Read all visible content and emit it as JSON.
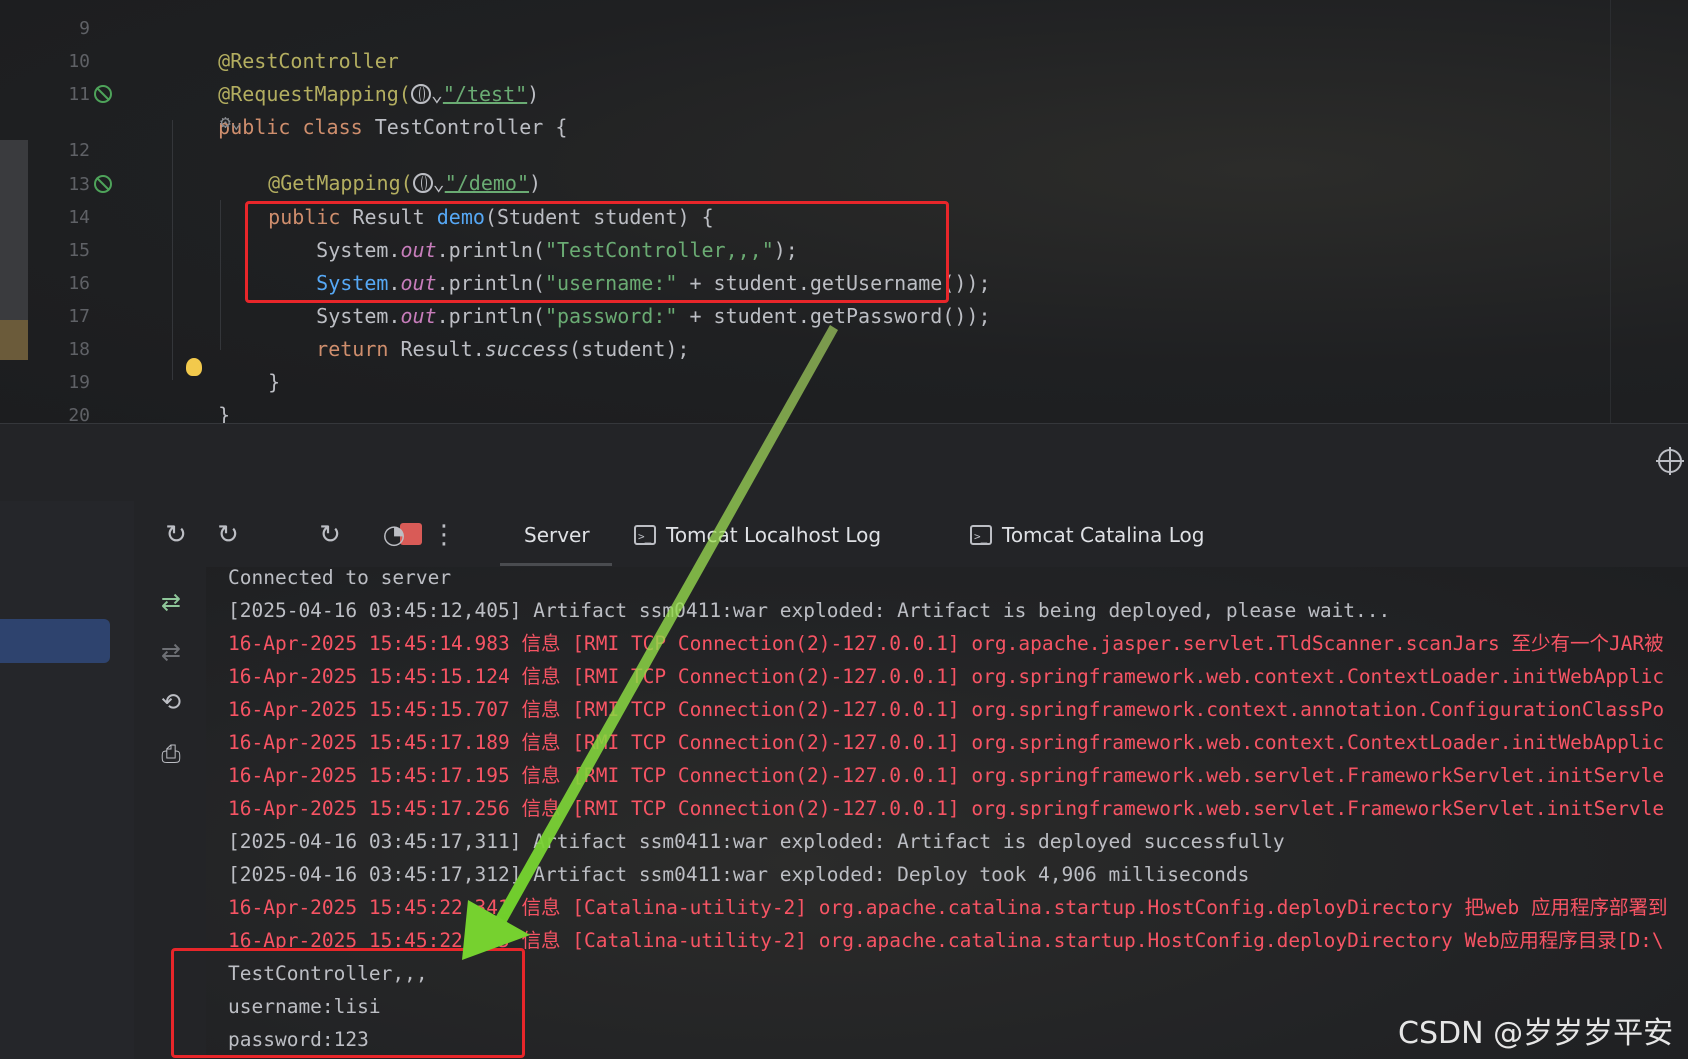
{
  "editor": {
    "line_numbers": [
      "9",
      "10",
      "11",
      "",
      "12",
      "13",
      "14",
      "15",
      "16",
      "17",
      "18",
      "19",
      "20"
    ],
    "code": {
      "l9": "@RestController",
      "l10_ann": "@RequestMapping(",
      "l10_str": "\"/test\"",
      "l10_end": ")",
      "l11_kw": "public class",
      "l11_rest": " TestController {",
      "l12_ann": "@GetMapping(",
      "l12_str": "\"/demo\"",
      "l12_end": ")",
      "l13_kw": "public",
      "l13_type": " Result ",
      "l13_fn": "demo",
      "l13_rest": "(Student student) {",
      "l14_a": "System.",
      "l14_field": "out",
      "l14_b": ".println(",
      "l14_str": "\"TestController,,,\"",
      "l14_c": ");",
      "l15_a": "System",
      "l15_dot": ".",
      "l15_field": "out",
      "l15_b": ".println(",
      "l15_str": "\"username:\"",
      "l15_c": " + student.getUsername());",
      "l16_a": "System.",
      "l16_field": "out",
      "l16_b": ".println(",
      "l16_str": "\"password:\"",
      "l16_c": " + student.getPassword());",
      "l17_kw": "return",
      "l17_a": " Result.",
      "l17_static": "success",
      "l17_b": "(student);",
      "l18": "}",
      "l19": "}"
    }
  },
  "toolbar": {
    "tabs": [
      {
        "label": "Server"
      },
      {
        "label": "Tomcat Localhost Log"
      },
      {
        "label": "Tomcat Catalina Log"
      }
    ],
    "icons": [
      "rerun-icon",
      "debug-rerun-icon",
      "stop-icon",
      "restart-icon",
      "profiler-icon",
      "more-icon"
    ]
  },
  "console": {
    "lines": [
      {
        "text": "Connected to server",
        "color": "white"
      },
      {
        "text": "[2025-04-16 03:45:12,405] Artifact ssm0411:war exploded: Artifact is being deployed, please wait...",
        "color": "white"
      },
      {
        "text": "16-Apr-2025 15:45:14.983 信息 [RMI TCP Connection(2)-127.0.0.1] org.apache.jasper.servlet.TldScanner.scanJars 至少有一个JAR被",
        "color": "red"
      },
      {
        "text": "16-Apr-2025 15:45:15.124 信息 [RMI TCP Connection(2)-127.0.0.1] org.springframework.web.context.ContextLoader.initWebApplic",
        "color": "red"
      },
      {
        "text": "16-Apr-2025 15:45:15.707 信息 [RMI TCP Connection(2)-127.0.0.1] org.springframework.context.annotation.ConfigurationClassPo",
        "color": "red"
      },
      {
        "text": "16-Apr-2025 15:45:17.189 信息 [RMI TCP Connection(2)-127.0.0.1] org.springframework.web.context.ContextLoader.initWebApplic",
        "color": "red"
      },
      {
        "text": "16-Apr-2025 15:45:17.195 信息 [RMI TCP Connection(2)-127.0.0.1] org.springframework.web.servlet.FrameworkServlet.initServle",
        "color": "red"
      },
      {
        "text": "16-Apr-2025 15:45:17.256 信息 [RMI TCP Connection(2)-127.0.0.1] org.springframework.web.servlet.FrameworkServlet.initServle",
        "color": "red"
      },
      {
        "text": "[2025-04-16 03:45:17,311] Artifact ssm0411:war exploded: Artifact is deployed successfully",
        "color": "white"
      },
      {
        "text": "[2025-04-16 03:45:17,312] Artifact ssm0411:war exploded: Deploy took 4,906 milliseconds",
        "color": "white"
      },
      {
        "text": "16-Apr-2025 15:45:22.341 信息 [Catalina-utility-2] org.apache.catalina.startup.HostConfig.deployDirectory 把web 应用程序部署到",
        "color": "red"
      },
      {
        "text": "16-Apr-2025 15:45:22.355 信息 [Catalina-utility-2] org.apache.catalina.startup.HostConfig.deployDirectory Web应用程序目录[D:\\",
        "color": "red"
      },
      {
        "text": "TestController,,,",
        "color": "white"
      },
      {
        "text": "username:lisi",
        "color": "white"
      },
      {
        "text": "password:123",
        "color": "white"
      }
    ]
  },
  "watermark": "CSDN @岁岁岁平安",
  "colors": {
    "highlight_box": "#e8262a",
    "arrow": "#7fd13b",
    "log_red": "#f75464"
  }
}
